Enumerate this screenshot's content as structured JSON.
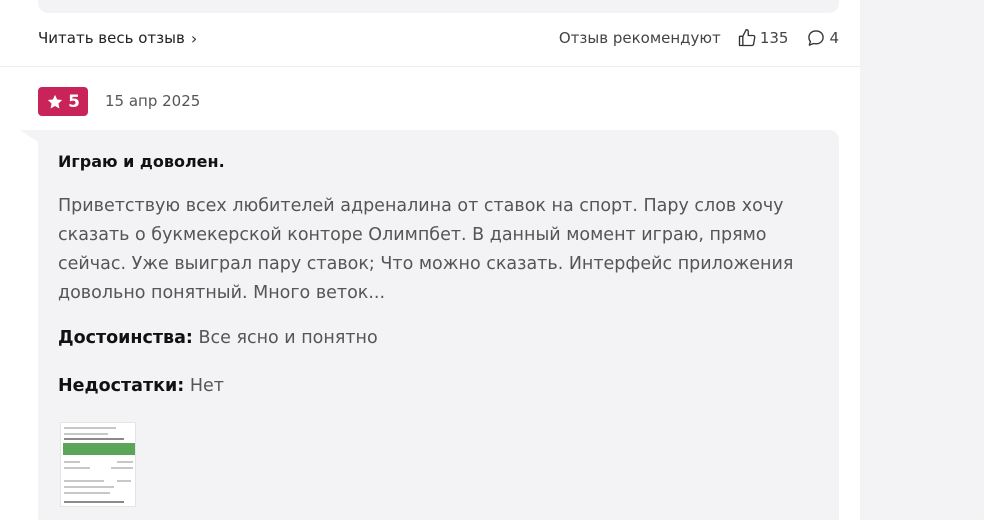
{
  "prev_review": {
    "read_full_label": "Читать весь отзыв",
    "recommend_label": "Отзыв рекомендуют",
    "likes": "135",
    "comments": "4"
  },
  "review": {
    "rating": "5",
    "date": "15 апр 2025",
    "title": "Играю и доволен.",
    "text": "Приветствую всех любителей адреналина от ставок на спорт. Пару слов хочу сказать о букмекерской конторе Олимпбет. В данный момент играю, прямо сейчас. Уже выиграл пару ставок; Что можно сказать. Интерфейс приложения довольно понятный. Много веток...",
    "pros_label": "Достоинства:",
    "pros_value": "Все ясно и понятно",
    "cons_label": "Недостатки:",
    "cons_value": "Нет"
  },
  "colors": {
    "badge": "#c9245a",
    "card_bg": "#f3f3f5"
  }
}
